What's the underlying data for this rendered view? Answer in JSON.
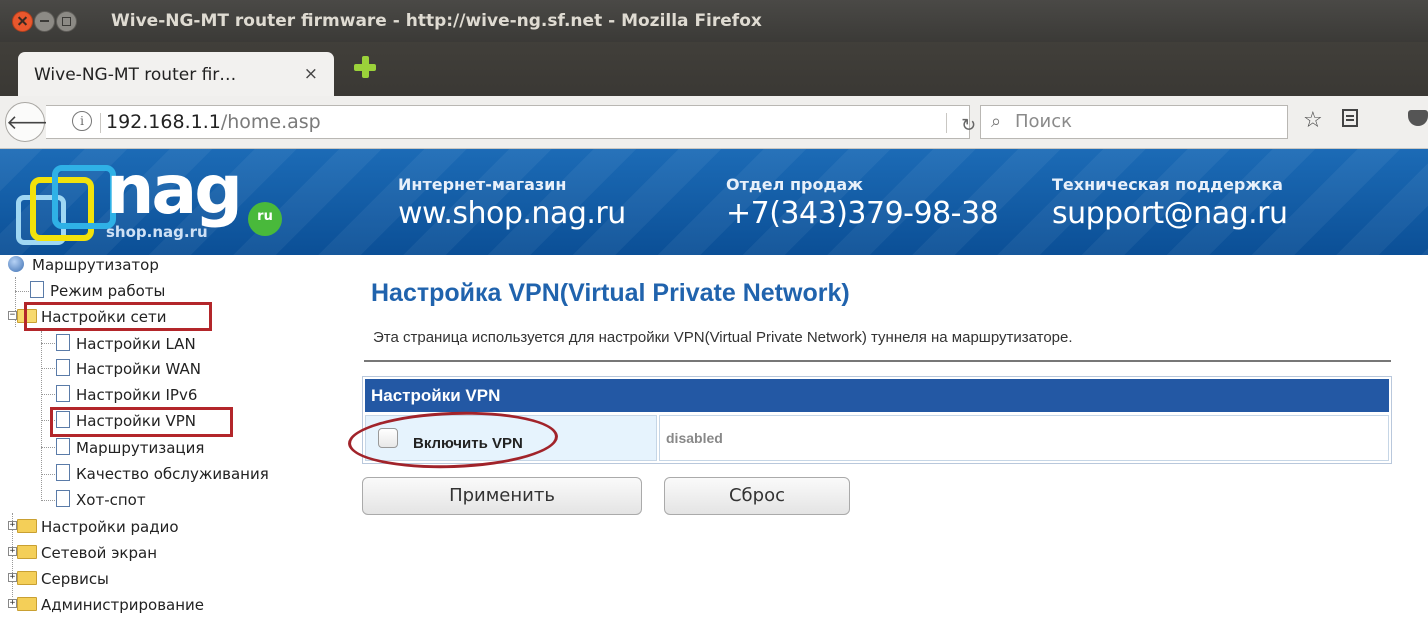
{
  "window": {
    "title": "Wive-NG-MT router firmware - http://wive-ng.sf.net - Mozilla Firefox"
  },
  "tab": {
    "label": "Wive-NG-MT router fir…",
    "close": "×"
  },
  "navbar": {
    "url_host": "192.168.1.1",
    "url_path": "/home.asp",
    "search_placeholder": "Поиск"
  },
  "banner": {
    "logo_text": "nag",
    "logo_sub": "shop.nag.ru",
    "logo_badge": "ru",
    "blocks": [
      {
        "label": "Интернет-магазин",
        "value": "ww.shop.nag.ru"
      },
      {
        "label": "Отдел продаж",
        "value": "+7(343)379-98-38"
      },
      {
        "label": "Техническая поддержка",
        "value": "support@nag.ru"
      }
    ]
  },
  "tree": {
    "root": "Маршрутизатор",
    "items": [
      {
        "label": "Режим работы"
      },
      {
        "label": "Настройки сети"
      },
      {
        "label": "Настройки LAN"
      },
      {
        "label": "Настройки WAN"
      },
      {
        "label": "Настройки IPv6"
      },
      {
        "label": "Настройки VPN"
      },
      {
        "label": "Маршрутизация"
      },
      {
        "label": "Качество обслуживания"
      },
      {
        "label": "Хот-спот"
      },
      {
        "label": "Настройки радио"
      },
      {
        "label": "Сетевой экран"
      },
      {
        "label": "Сервисы"
      },
      {
        "label": "Администрирование"
      }
    ],
    "expand_plus": "+",
    "expand_minus": "−"
  },
  "main": {
    "title": "Настройка VPN(Virtual Private Network)",
    "description": "Эта страница используется для настройки VPN(Virtual Private Network) туннеля на маршрутизаторе.",
    "table_header": "Настройки VPN",
    "enable_label": "Включить VPN",
    "enable_status": "disabled",
    "apply_button": "Применить",
    "reset_button": "Сброс"
  },
  "colors": {
    "accent_title": "#2063ad",
    "table_header_bg": "#2358a4",
    "annotation_red": "#b3262a",
    "banner_bg": "#0b4f96"
  }
}
